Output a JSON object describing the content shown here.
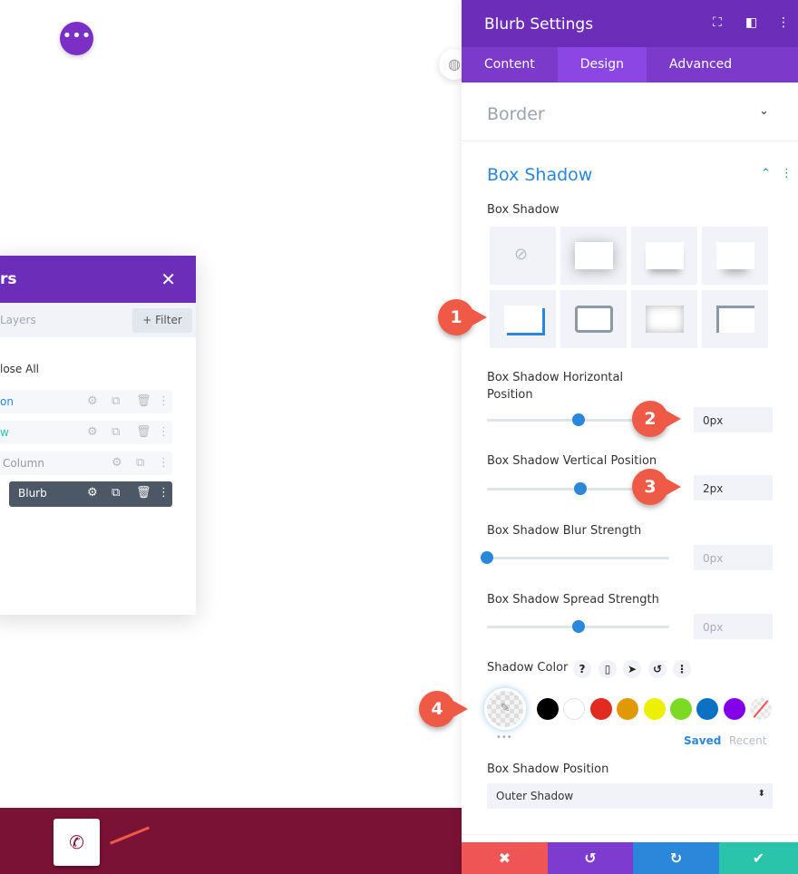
{
  "canvas": {
    "more_icon": "ellipsis-horizontal",
    "globe_icon": "globe"
  },
  "layers": {
    "title_partial": "rs",
    "search_partial": "Layers",
    "filter_label": "+ Filter",
    "close_all_partial": "lose All",
    "rows": [
      {
        "label": "on",
        "color": "#2b87da"
      },
      {
        "label": "w",
        "color": "#29c4a9"
      },
      {
        "label": "Column",
        "color": "#999"
      },
      {
        "label": "Blurb",
        "color": "#fff"
      }
    ]
  },
  "panel": {
    "title": "Blurb Settings",
    "tabs": [
      {
        "label": "Content"
      },
      {
        "label": "Design"
      },
      {
        "label": "Advanced"
      }
    ],
    "active_tab": "Design",
    "border_title": "Border",
    "box_shadow_title": "Box Shadow",
    "box_shadow_label": "Box Shadow",
    "sliders": [
      {
        "label": "Box Shadow Horizontal Position",
        "value": "0px",
        "fraction": 0.5
      },
      {
        "label": "Box Shadow Vertical Position",
        "value": "2px",
        "fraction": 0.51
      },
      {
        "label": "Box Shadow Blur Strength",
        "value": "0px",
        "fraction": 0.0
      },
      {
        "label": "Box Shadow Spread Strength",
        "value": "0px",
        "fraction": 0.5
      }
    ],
    "shadow_color_label": "Shadow Color",
    "saved": "Saved",
    "recent": "Recent",
    "swatches": [
      "#000000",
      "#ffffff",
      "#e02b20",
      "#e09900",
      "#edf000",
      "#7cda24",
      "#0c71c3",
      "#8300e9"
    ],
    "position_label": "Box Shadow Position",
    "position_value": "Outer Shadow"
  },
  "badges": [
    "1",
    "2",
    "3",
    "4"
  ],
  "footer": {
    "colors": [
      "#ef5555",
      "#7e3bd0",
      "#2b87da",
      "#29c4a9"
    ]
  },
  "bottom_bar_color": "#7a1236"
}
